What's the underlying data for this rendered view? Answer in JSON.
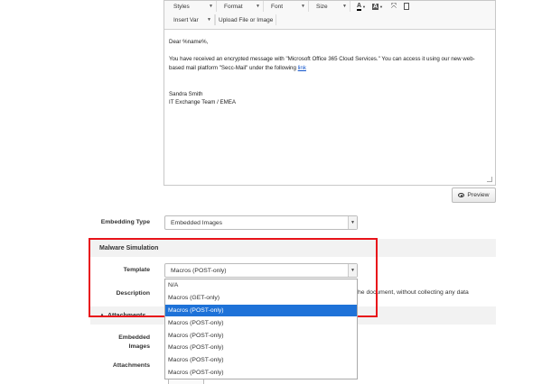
{
  "toolbar": {
    "styles": "Styles",
    "format": "Format",
    "font": "Font",
    "size": "Size",
    "insert_var": "Insert Var",
    "upload": "Upload File or Image"
  },
  "editor": {
    "greeting": "Dear %name%,",
    "line1": "You have received an encrypted message with \"Microsoft Office 365 Cloud Services.\" You can access it using our new web-",
    "line2_prefix": "based mail platform \"Secc-Mail\" under the following ",
    "link": "link",
    "sig_name": "Sandra Smith",
    "sig_team": "IT Exchange Team / EMEA"
  },
  "preview_label": "Preview",
  "embedding": {
    "label": "Embedding Type",
    "value": "Embedded Images"
  },
  "malware": {
    "section_title": "Malware Simulation",
    "template_label": "Template",
    "template_value": "Macros (POST-only)",
    "description_label": "Description",
    "description_text": "he document, without collecting any data"
  },
  "attachments": {
    "section_title": "Attachments",
    "embedded_images_label_1": "Embedded",
    "embedded_images_label_2": "Images",
    "attachments_label": "Attachments"
  },
  "dropdown_options": [
    "N/A",
    "Macros (GET-only)",
    "Macros (POST-only)",
    "Macros (POST-only)",
    "Macros (POST-only)",
    "Macros (POST-only)",
    "Macros (POST-only)",
    "Macros (POST-only)"
  ],
  "dropdown_selected_index": 2,
  "colors": {
    "highlight": "#1e72d8",
    "annotation_red": "#e8131a"
  }
}
